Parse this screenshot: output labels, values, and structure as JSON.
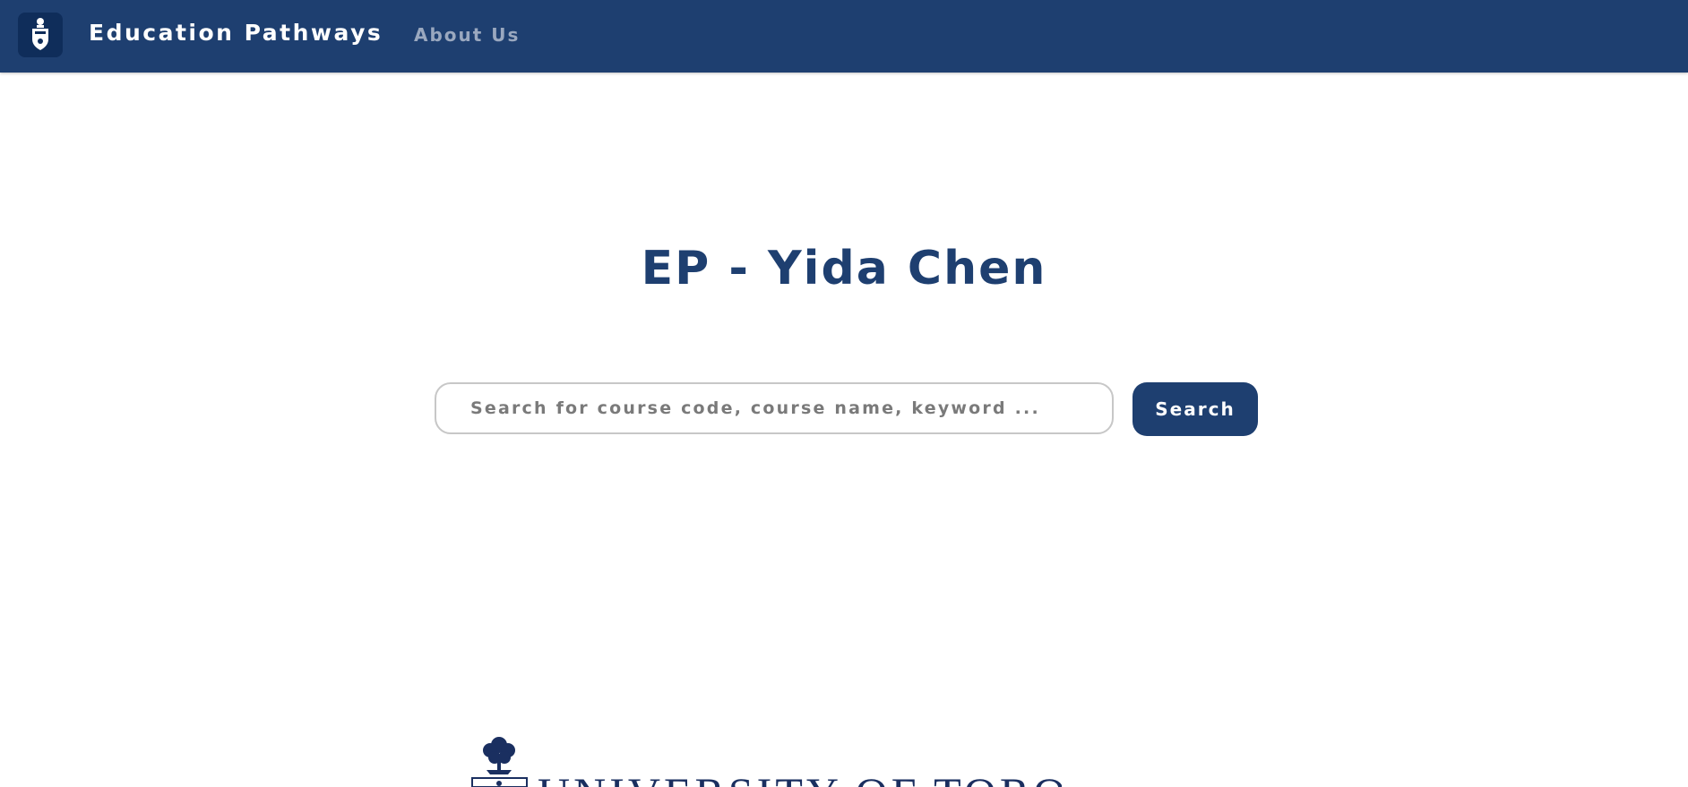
{
  "navbar": {
    "brand": "Education Pathways",
    "links": [
      {
        "label": "About Us"
      }
    ]
  },
  "main": {
    "title": "EP - Yida Chen",
    "search": {
      "placeholder": "Search for course code, course name, keyword ...",
      "value": "",
      "button_label": "Search"
    }
  },
  "footer": {
    "logo_text": "UNIVERSITY OF TORONTO"
  },
  "colors": {
    "primary": "#1e3f70",
    "nav_link": "#9aa8bf",
    "logo_navy": "#1a2f60"
  }
}
